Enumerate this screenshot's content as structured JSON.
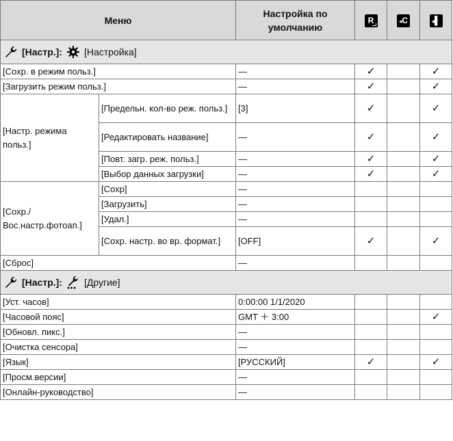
{
  "header": {
    "menu": "Меню",
    "default": "Настройка по умолчанию",
    "icon1": "R",
    "icon2": "C",
    "icon3": "▌"
  },
  "section1": {
    "bold": "[Настр.]:",
    "name": "[Настройка]"
  },
  "section2": {
    "bold": "[Настр.]:",
    "name": "[Другие]"
  },
  "rows1": [
    {
      "a": "[Сохр. в режим польз.]",
      "d": "—",
      "c1": "✓",
      "c2": "",
      "c3": "✓"
    },
    {
      "a": "[Загрузить режим польз.]",
      "d": "—",
      "c1": "✓",
      "c2": "",
      "c3": "✓"
    }
  ],
  "group1": {
    "label": "[Настр. режима польз.]",
    "rows": [
      {
        "b": "[Предельн. кол-во реж. польз.]",
        "d": "[3]",
        "c1": "✓",
        "c2": "",
        "c3": "✓"
      },
      {
        "b": "[Редактировать название]",
        "d": "—",
        "c1": "✓",
        "c2": "",
        "c3": "✓"
      },
      {
        "b": "[Повт. загр. реж. польз.]",
        "d": "—",
        "c1": "✓",
        "c2": "",
        "c3": "✓"
      },
      {
        "b": "[Выбор данных загрузки]",
        "d": "—",
        "c1": "✓",
        "c2": "",
        "c3": "✓"
      }
    ]
  },
  "group2": {
    "label": "[Сохр./ Вос.настр.фотоап.]",
    "rows": [
      {
        "b": "[Сохр]",
        "d": "—",
        "c1": "",
        "c2": "",
        "c3": ""
      },
      {
        "b": "[Загрузить]",
        "d": "—",
        "c1": "",
        "c2": "",
        "c3": ""
      },
      {
        "b": "[Удал.]",
        "d": "—",
        "c1": "",
        "c2": "",
        "c3": ""
      },
      {
        "b": "[Сохр. настр. во вр. формат.]",
        "d": "[OFF]",
        "c1": "✓",
        "c2": "",
        "c3": "✓"
      }
    ]
  },
  "reset": {
    "a": "[Сброс]",
    "d": "—",
    "c1": "",
    "c2": "",
    "c3": ""
  },
  "rows2": [
    {
      "a": "[Уст. часов]",
      "d": "0:00:00 1/1/2020",
      "c1": "",
      "c2": "",
      "c3": ""
    },
    {
      "a": "[Часовой пояс]",
      "d": "GMT ＋ 3:00",
      "c1": "",
      "c2": "",
      "c3": "✓"
    },
    {
      "a": "[Обновл. пикс.]",
      "d": "—",
      "c1": "",
      "c2": "",
      "c3": ""
    },
    {
      "a": "[Очистка сенсора]",
      "d": "—",
      "c1": "",
      "c2": "",
      "c3": ""
    },
    {
      "a": "[Язык]",
      "d": "[РУССКИЙ]",
      "c1": "✓",
      "c2": "",
      "c3": "✓"
    },
    {
      "a": "[Просм.версии]",
      "d": "—",
      "c1": "",
      "c2": "",
      "c3": ""
    },
    {
      "a": "[Онлайн-руководство]",
      "d": "—",
      "c1": "",
      "c2": "",
      "c3": ""
    }
  ]
}
